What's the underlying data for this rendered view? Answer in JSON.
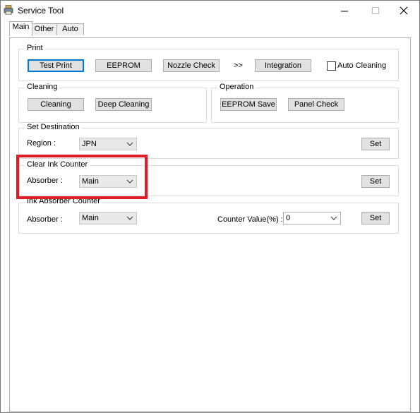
{
  "window": {
    "title": "Service Tool",
    "min_glyph": "—",
    "max_glyph": "☐",
    "close_glyph": "✕"
  },
  "tabs": [
    {
      "label": "Main",
      "active": true
    },
    {
      "label": "Other",
      "active": false
    },
    {
      "label": "Auto",
      "active": false
    }
  ],
  "print": {
    "group_label": "Print",
    "test_print": "Test Print",
    "eeprom": "EEPROM",
    "nozzle_check": "Nozzle Check",
    "arrows": ">>",
    "integration": "Integration",
    "auto_cleaning_label": "Auto Cleaning",
    "auto_cleaning_checked": false
  },
  "cleaning": {
    "group_label": "Cleaning",
    "cleaning": "Cleaning",
    "deep_cleaning": "Deep Cleaning"
  },
  "operation": {
    "group_label": "Operation",
    "eeprom_save": "EEPROM Save",
    "panel_check": "Panel Check"
  },
  "set_destination": {
    "group_label": "Set Destination",
    "region_label": "Region :",
    "region_value": "JPN",
    "set": "Set"
  },
  "clear_ink_counter": {
    "group_label": "Clear Ink Counter",
    "absorber_label": "Absorber :",
    "absorber_value": "Main",
    "set": "Set"
  },
  "ink_absorber_counter": {
    "group_label": "Ink Absorber Counter",
    "absorber_label": "Absorber :",
    "absorber_value": "Main",
    "counter_label": "Counter Value(%) :",
    "counter_value": "0",
    "set": "Set"
  },
  "colors": {
    "highlight": "#dd1e26",
    "default_button_border": "#0078d7"
  }
}
